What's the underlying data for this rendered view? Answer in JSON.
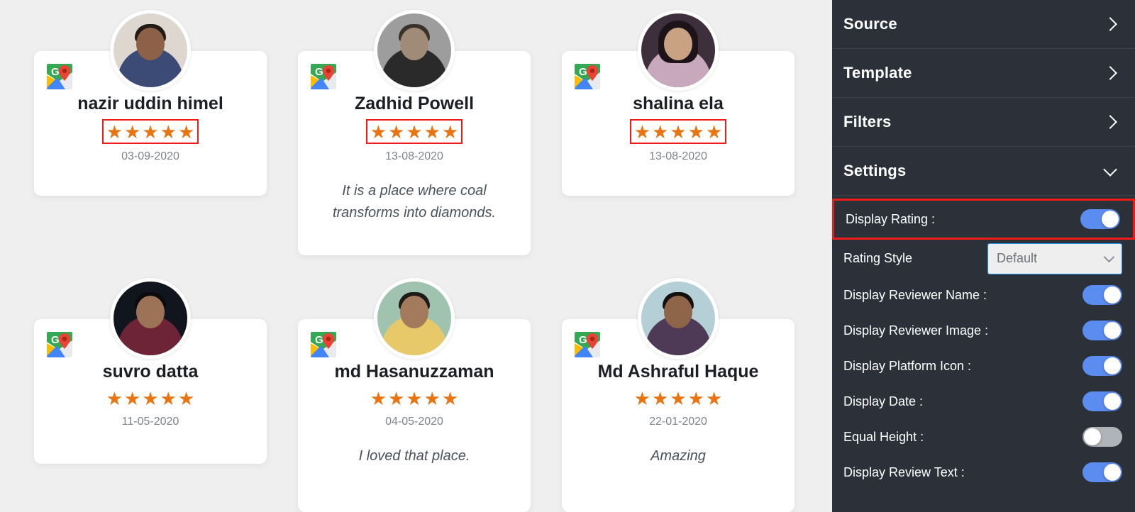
{
  "reviews": [
    {
      "name": "nazir uddin himel",
      "stars": 5,
      "date": "03-09-2020",
      "text": "",
      "platform_icon": "google-maps-icon",
      "rating_highlighted": true
    },
    {
      "name": "Zadhid Powell",
      "stars": 5,
      "date": "13-08-2020",
      "text": "It is a place where coal transforms into diamonds.",
      "platform_icon": "google-maps-icon",
      "rating_highlighted": true
    },
    {
      "name": "shalina ela",
      "stars": 5,
      "date": "13-08-2020",
      "text": "",
      "platform_icon": "google-maps-icon",
      "rating_highlighted": true
    },
    {
      "name": "suvro datta",
      "stars": 5,
      "date": "11-05-2020",
      "text": "",
      "platform_icon": "google-maps-icon",
      "rating_highlighted": false
    },
    {
      "name": "md Hasanuzzaman",
      "stars": 5,
      "date": "04-05-2020",
      "text": "I loved that place.",
      "platform_icon": "google-maps-icon",
      "rating_highlighted": false
    },
    {
      "name": "Md Ashraful Haque",
      "stars": 5,
      "date": "22-01-2020",
      "text": "Amazing",
      "platform_icon": "google-maps-icon",
      "rating_highlighted": false
    }
  ],
  "sidebar": {
    "accordions": [
      {
        "label": "Source",
        "state": "collapsed",
        "icon": "chevron-right-icon"
      },
      {
        "label": "Template",
        "state": "collapsed",
        "icon": "chevron-right-icon"
      },
      {
        "label": "Filters",
        "state": "collapsed",
        "icon": "chevron-right-icon"
      },
      {
        "label": "Settings",
        "state": "expanded",
        "icon": "chevron-down-icon"
      }
    ],
    "settings": [
      {
        "label": "Display Rating :",
        "control": "toggle",
        "value": "on",
        "highlighted": true
      },
      {
        "label": "Rating Style",
        "control": "select",
        "value": "Default",
        "highlighted": false
      },
      {
        "label": "Display Reviewer Name :",
        "control": "toggle",
        "value": "on",
        "highlighted": false
      },
      {
        "label": "Display Reviewer Image :",
        "control": "toggle",
        "value": "on",
        "highlighted": false
      },
      {
        "label": "Display Platform Icon :",
        "control": "toggle",
        "value": "on",
        "highlighted": false
      },
      {
        "label": "Display Date :",
        "control": "toggle",
        "value": "on",
        "highlighted": false
      },
      {
        "label": "Equal Height :",
        "control": "toggle",
        "value": "off",
        "highlighted": false
      },
      {
        "label": "Display Review Text :",
        "control": "toggle",
        "value": "on",
        "highlighted": false
      }
    ]
  },
  "colors": {
    "page_background": "#efefef",
    "card_background": "#ffffff",
    "sidebar_background": "#2b3039",
    "star": "#e87511",
    "toggle_on": "#5b8cf0",
    "toggle_off": "#b0b3b8",
    "highlight_outline": "#ee1b18",
    "select_border": "#2196f3",
    "name_text": "#1b1f24",
    "date_text": "#7c8489",
    "review_text": "#4a525a"
  },
  "icons": {
    "star": "★",
    "google_maps": "google-maps-icon",
    "chevron_right": "chevron-right-icon",
    "chevron_down": "chevron-down-icon"
  }
}
